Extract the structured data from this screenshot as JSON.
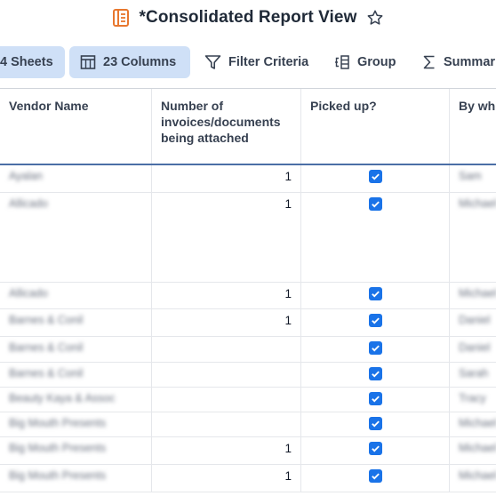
{
  "title": "*Consolidated Report View",
  "toolbar": {
    "sheets": "4 Sheets",
    "columns": "23 Columns",
    "filter": "Filter Criteria",
    "group": "Group",
    "summary": "Summar"
  },
  "columns": {
    "vendor": "Vendor Name",
    "number": "Number of invoices/documents being attached",
    "picked": "Picked up?",
    "by": "By wh"
  },
  "rows": [
    {
      "vendor": "Ayalan",
      "number": "1",
      "picked": true,
      "by": "Sam"
    },
    {
      "vendor": "Allicado",
      "number": "1",
      "picked": true,
      "by": "Michael"
    },
    {
      "vendor": "Allicado",
      "number": "1",
      "picked": true,
      "by": "Michael"
    },
    {
      "vendor": "Barnes & Conil",
      "number": "1",
      "picked": true,
      "by": "Daniel"
    },
    {
      "vendor": "Barnes & Conil",
      "number": "",
      "picked": true,
      "by": "Daniel"
    },
    {
      "vendor": "Barnes & Conil",
      "number": "",
      "picked": true,
      "by": "Sarah"
    },
    {
      "vendor": "Beauty Kaya & Assoc",
      "number": "",
      "picked": true,
      "by": "Tracy"
    },
    {
      "vendor": "Big Mouth Presents",
      "number": "",
      "picked": true,
      "by": "Michael"
    },
    {
      "vendor": "Big Mouth Presents",
      "number": "1",
      "picked": true,
      "by": "Michael"
    },
    {
      "vendor": "Big Mouth Presents",
      "number": "1",
      "picked": true,
      "by": "Michael"
    }
  ],
  "colors": {
    "accent": "#1a73e8",
    "active_button": "#cfe0f7",
    "title_icon": "#e8772e"
  },
  "icons": {
    "title": "report-icon",
    "favorite": "star-icon",
    "columns": "columns-icon",
    "filter": "filter-icon",
    "group": "group-icon",
    "summary": "sigma-icon",
    "check": "checkbox-checked-icon"
  }
}
